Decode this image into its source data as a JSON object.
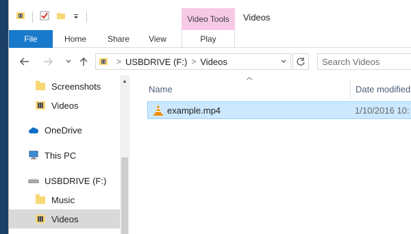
{
  "window": {
    "title": "Videos"
  },
  "ribbon": {
    "context_header": "Video Tools",
    "tabs": {
      "file": "File",
      "home": "Home",
      "share": "Share",
      "view": "View",
      "play": "Play"
    }
  },
  "address": {
    "root": "USBDRIVE (F:)",
    "current": "Videos",
    "separator": ">"
  },
  "search": {
    "placeholder": "Search Videos"
  },
  "nav": {
    "items": [
      {
        "label": "Screenshots",
        "icon": "folder-icon"
      },
      {
        "label": "Videos",
        "icon": "video-folder-icon"
      },
      {
        "label": "OneDrive",
        "icon": "onedrive-cloud-icon"
      },
      {
        "label": "This PC",
        "icon": "computer-icon"
      },
      {
        "label": "USBDRIVE (F:)",
        "icon": "usb-drive-icon"
      },
      {
        "label": "Music",
        "icon": "folder-icon"
      },
      {
        "label": "Videos",
        "icon": "video-folder-icon",
        "selected": true
      }
    ]
  },
  "columns": {
    "name": "Name",
    "date": "Date modified"
  },
  "files": [
    {
      "name": "example.mp4",
      "date": "1/10/2016 10:",
      "icon": "vlc-cone-icon"
    }
  ],
  "colors": {
    "accent": "#1979ca",
    "context_tab": "#f6c9e6",
    "selection": "#cce8ff",
    "desktop": "#1c3f66"
  }
}
